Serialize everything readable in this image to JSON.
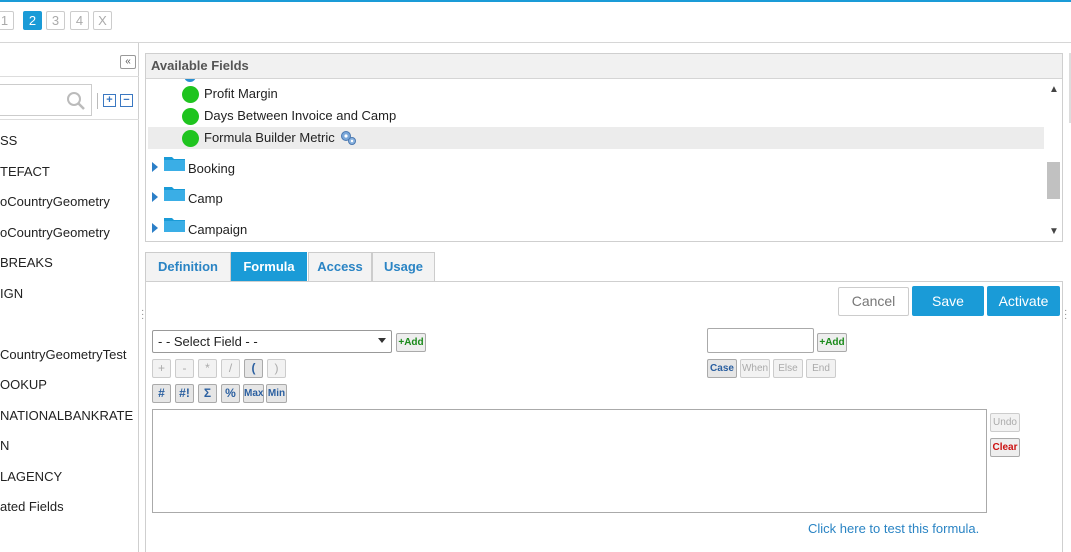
{
  "wizard": {
    "steps": [
      "1",
      "2",
      "3",
      "4"
    ],
    "active_step": "2",
    "close_label": "X"
  },
  "left_panel": {
    "items": [
      "SS",
      "TEFACT",
      "oCountryGeometry",
      "oCountryGeometry",
      "BREAKS",
      "IGN",
      "",
      "CountryGeometryTest",
      "OOKUP",
      "NATIONALBANKRATE",
      "N",
      "LAGENCY",
      "ated Fields"
    ]
  },
  "available_fields": {
    "title": "Available Fields",
    "metrics": [
      "Profit Margin",
      "Days Between Invoice and Camp",
      "Formula Builder Metric"
    ],
    "folders": [
      "Booking",
      "Camp",
      "Campaign"
    ]
  },
  "tabs": [
    "Definition",
    "Formula",
    "Access",
    "Usage"
  ],
  "active_tab": "Formula",
  "actions": {
    "cancel": "Cancel",
    "save": "Save",
    "activate": "Activate"
  },
  "formula": {
    "select_field": "- - Select Field - -",
    "add_label": "+Add",
    "text_value": "",
    "operators": [
      "+",
      "-",
      "*",
      "/",
      "(",
      ")"
    ],
    "functions": [
      "#",
      "#!",
      "Σ",
      "%",
      "Max",
      "Min"
    ],
    "case_buttons": [
      "Case",
      "When",
      "Else",
      "End"
    ],
    "undo": "Undo",
    "clear": "Clear",
    "test_link": "Click here to test this formula."
  },
  "colors": {
    "accent": "#1a9bd7",
    "metric_dot": "#1fc41f",
    "link": "#2a84c4"
  }
}
